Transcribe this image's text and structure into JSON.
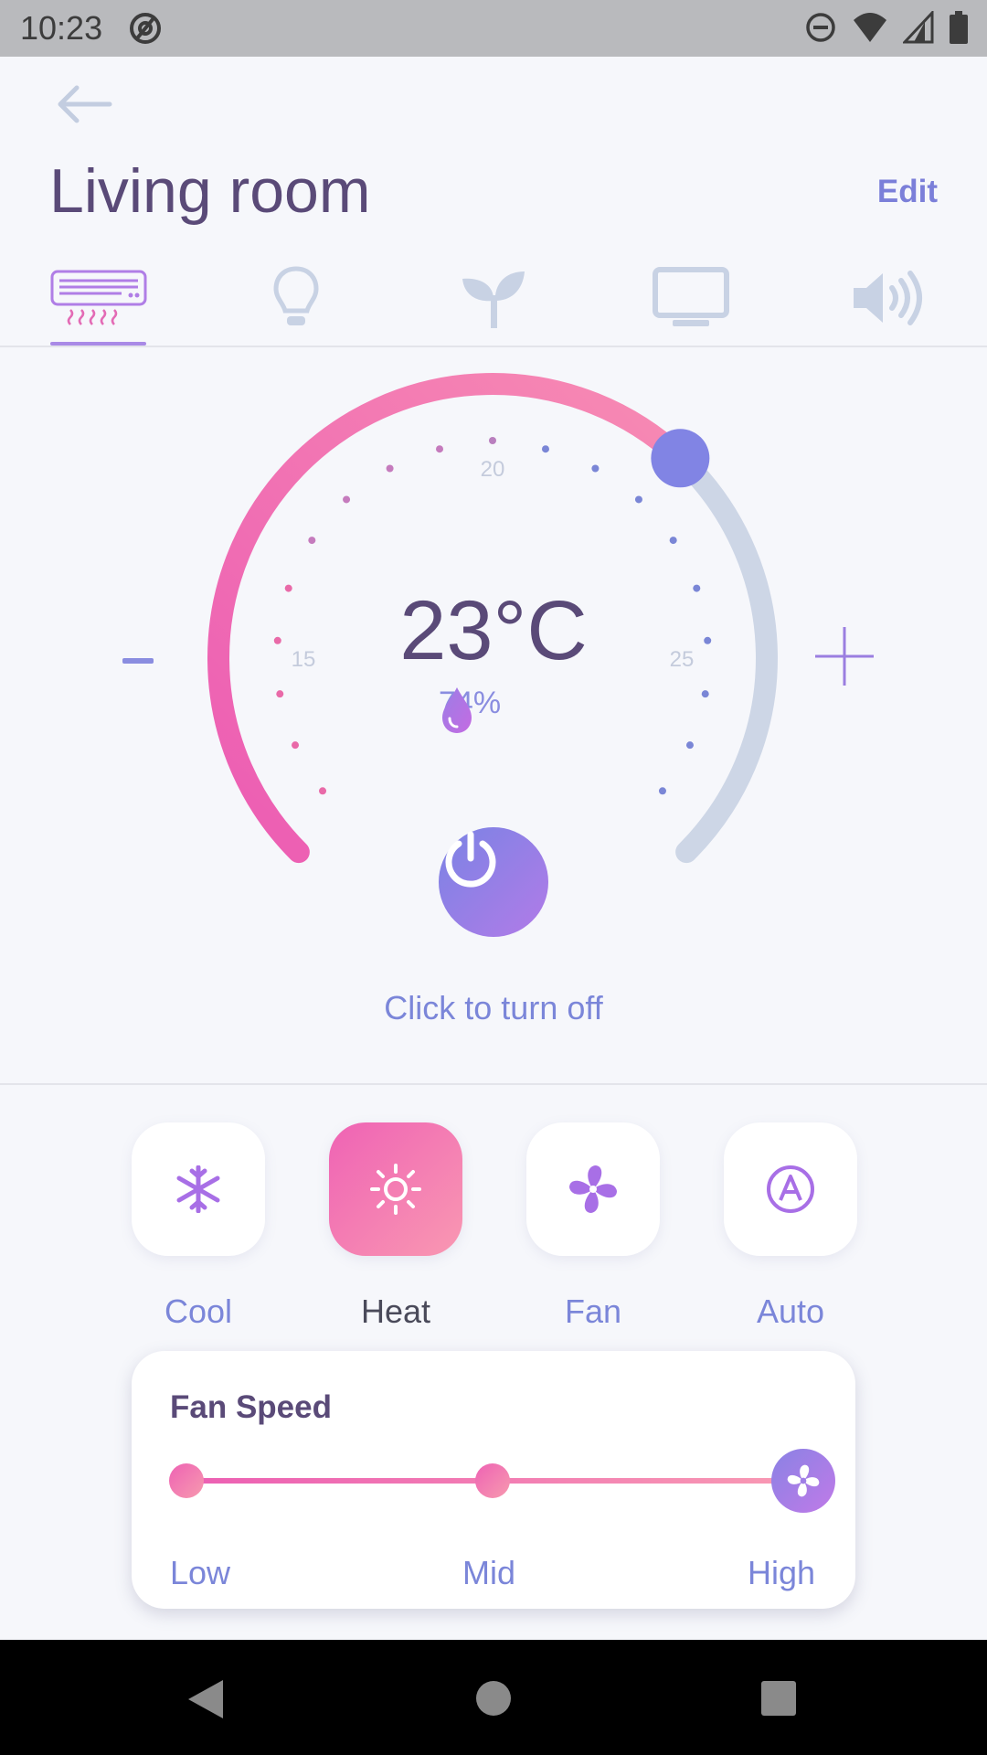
{
  "status": {
    "time": "10:23"
  },
  "header": {
    "title": "Living room",
    "edit_label": "Edit"
  },
  "tabs": [
    {
      "icon": "air-conditioner-icon",
      "active": true
    },
    {
      "icon": "lightbulb-icon",
      "active": false
    },
    {
      "icon": "plant-icon",
      "active": false
    },
    {
      "icon": "monitor-icon",
      "active": false
    },
    {
      "icon": "speaker-icon",
      "active": false
    }
  ],
  "thermostat": {
    "temperature": "23°C",
    "humidity": "74%",
    "scale_labels": {
      "low": "15",
      "mid": "20",
      "high": "25"
    },
    "power_label": "Click to turn off",
    "setpoint_fraction": 0.66
  },
  "modes": [
    {
      "label": "Cool",
      "icon": "snowflake-icon",
      "active": false
    },
    {
      "label": "Heat",
      "icon": "sun-icon",
      "active": true
    },
    {
      "label": "Fan",
      "icon": "fan-icon",
      "active": false
    },
    {
      "label": "Auto",
      "icon": "auto-icon",
      "active": false
    }
  ],
  "fan_speed": {
    "title": "Fan Speed",
    "low": "Low",
    "mid": "Mid",
    "high": "High",
    "selected": "High"
  },
  "colors": {
    "accent": "#7b86d9",
    "title": "#5a4a78",
    "heat_gradient_start": "#ef63b4",
    "heat_gradient_end": "#f998b2",
    "arc_inactive": "#cdd6e6"
  }
}
